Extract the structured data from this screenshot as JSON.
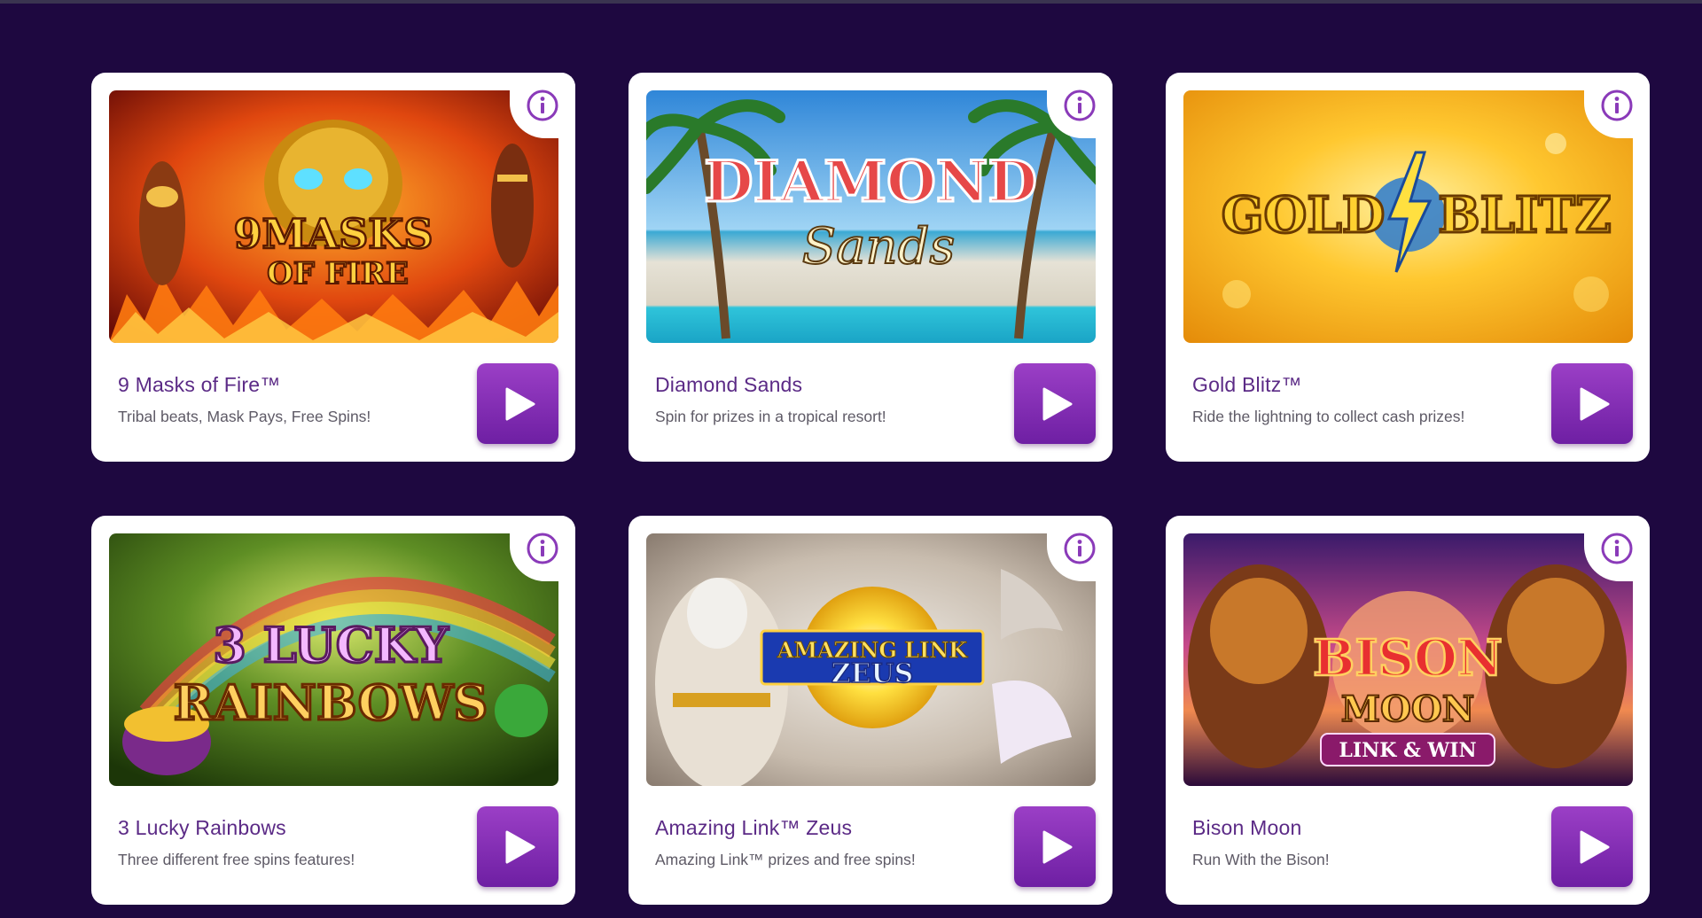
{
  "games": [
    {
      "title": "9 Masks of Fire™",
      "description": "Tribal beats, Mask Pays, Free Spins!",
      "art": {
        "line1": "9MASKS",
        "line2": "OF FIRE",
        "colors": [
          "#f7a21a",
          "#c82a0c",
          "#5a0a05"
        ]
      }
    },
    {
      "title": "Diamond Sands",
      "description": "Spin for prizes in a tropical resort!",
      "art": {
        "line1": "DIAMOND",
        "line2": "Sands",
        "colors": [
          "#4aa8e8",
          "#e8e4d8",
          "#2bc0d8"
        ]
      }
    },
    {
      "title": "Gold Blitz™",
      "description": "Ride the lightning to collect cash prizes!",
      "art": {
        "line1": "GOLD",
        "line2": "BLITZ",
        "colors": [
          "#ffd65a",
          "#f0a01c",
          "#b86a06"
        ]
      }
    },
    {
      "title": "3 Lucky Rainbows",
      "description": "Three different free spins features!",
      "art": {
        "line1": "3 LUCKY",
        "line2": "RAINBOWS",
        "colors": [
          "#6d9a2a",
          "#3b5e14",
          "#1e3a0a"
        ]
      }
    },
    {
      "title": "Amazing Link™ Zeus",
      "description": "Amazing Link™ prizes and free spins!",
      "art": {
        "line1": "AMAZING LINK",
        "line2": "ZEUS",
        "colors": [
          "#d8d4d0",
          "#b8a890",
          "#8a7a6a"
        ]
      }
    },
    {
      "title": "Bison Moon",
      "description": "Run With the Bison!",
      "art": {
        "line1": "BISON",
        "line2": "MOON",
        "line3": "LINK & WIN",
        "colors": [
          "#b83a8a",
          "#5a1a6a",
          "#2a0a3a"
        ]
      }
    }
  ],
  "colors": {
    "page_background": "#1e0840",
    "card_background": "#ffffff",
    "title_color": "#5b2a86",
    "play_button": "#7e2ab3",
    "info_icon": "#8a3ab9"
  },
  "icons": {
    "info": "info-icon",
    "play": "play-icon"
  }
}
